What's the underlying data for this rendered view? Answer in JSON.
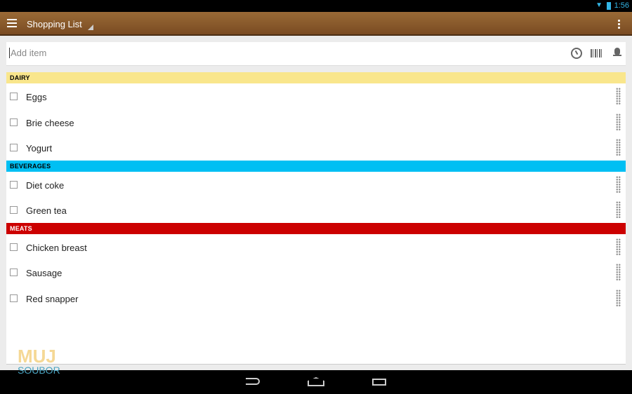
{
  "status_bar": {
    "time": "1:56",
    "wifi_icon": "wifi-icon",
    "battery_icon": "battery-charging-icon"
  },
  "action_bar": {
    "title": "Shopping List"
  },
  "add_item": {
    "placeholder": "Add item",
    "value": ""
  },
  "categories": [
    {
      "name": "DAIRY",
      "color": "#f9e68c",
      "text_color": "#000000",
      "items": [
        "Eggs",
        "Brie cheese",
        "Yogurt"
      ]
    },
    {
      "name": "BEVERAGES",
      "color": "#00bff3",
      "text_color": "#000000",
      "items": [
        "Diet coke",
        "Green tea"
      ]
    },
    {
      "name": "MEATS",
      "color": "#cc0000",
      "text_color": "#ffffff",
      "items": [
        "Chicken breast",
        "Sausage",
        "Red snapper"
      ]
    }
  ],
  "watermark": {
    "line1": "MUJ",
    "line2": "SOUBOR"
  }
}
